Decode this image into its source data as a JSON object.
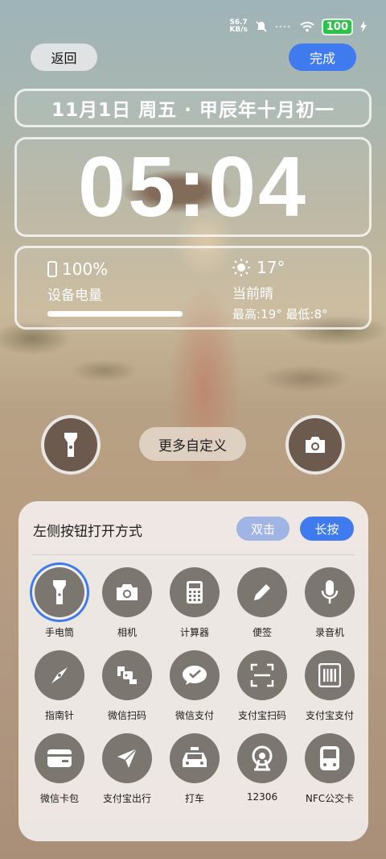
{
  "status_bar": {
    "net_speed_value": "56.7",
    "net_speed_unit": "KB/s",
    "battery": "100",
    "icons": [
      "mute-icon",
      "signal-icon",
      "wifi-icon",
      "battery-icon",
      "charging-icon"
    ]
  },
  "header": {
    "back_label": "返回",
    "done_label": "完成"
  },
  "lockscreen": {
    "date_line": "11月1日 周五 · 甲辰年十月初一",
    "time": "05:04",
    "battery_percent": "100%",
    "battery_label": "设备电量",
    "battery_level": 1.0,
    "temperature": "17°",
    "weather_desc": "当前晴",
    "weather_range": "最高:19° 最低:8°"
  },
  "shortcuts": {
    "left_icon": "flashlight-icon",
    "more_label": "更多自定义",
    "right_icon": "camera-icon"
  },
  "panel": {
    "title": "左侧按钮打开方式",
    "mode_double": "双击",
    "mode_long": "长按",
    "items": [
      {
        "label": "手电筒",
        "icon": "flashlight-icon",
        "selected": true
      },
      {
        "label": "相机",
        "icon": "camera-icon"
      },
      {
        "label": "计算器",
        "icon": "calculator-icon"
      },
      {
        "label": "便签",
        "icon": "pencil-icon"
      },
      {
        "label": "录音机",
        "icon": "microphone-icon"
      },
      {
        "label": "指南针",
        "icon": "compass-icon"
      },
      {
        "label": "微信扫码",
        "icon": "wechat-scan-icon"
      },
      {
        "label": "微信支付",
        "icon": "wechat-pay-icon"
      },
      {
        "label": "支付宝扫码",
        "icon": "scan-icon"
      },
      {
        "label": "支付宝支付",
        "icon": "barcode-icon"
      },
      {
        "label": "微信卡包",
        "icon": "wallet-icon"
      },
      {
        "label": "支付宝出行",
        "icon": "navigation-icon"
      },
      {
        "label": "打车",
        "icon": "taxi-icon"
      },
      {
        "label": "12306",
        "icon": "railway-icon"
      },
      {
        "label": "NFC公交卡",
        "icon": "bus-card-icon"
      }
    ]
  },
  "colors": {
    "accent": "#3f7bef",
    "battery_green": "#2fc14c",
    "icon_circle": "#7c7671"
  }
}
